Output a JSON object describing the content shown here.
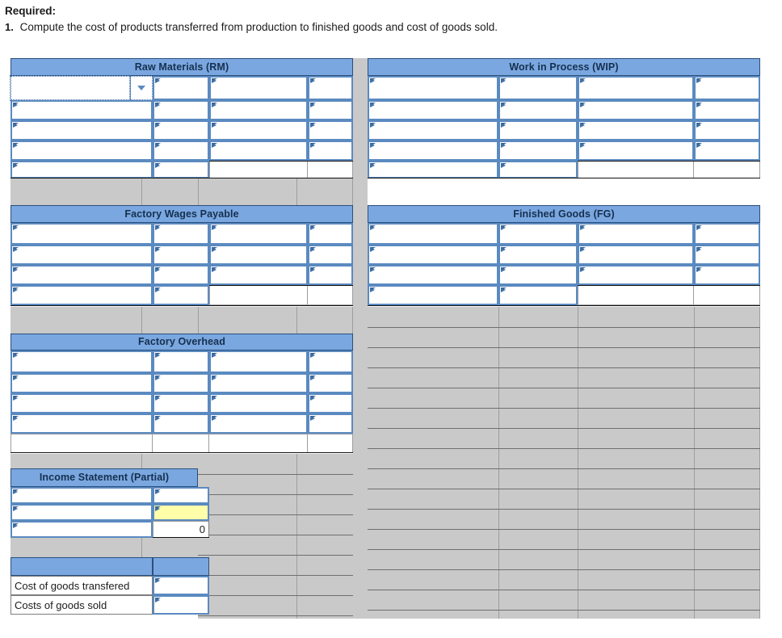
{
  "prompt": {
    "required_label": "Required:",
    "item_number": "1.",
    "item_text": "Compute the cost of products transferred from production to finished goods and cost of goods sold."
  },
  "colors": {
    "header_blue": "#7ba7e0",
    "header_border": "#2b4f7d",
    "input_border": "#5b8ac0",
    "sheet_gray": "#c9c9c9",
    "highlight_yellow": "#ffffaa",
    "text": "#1b1b1b"
  },
  "sections": {
    "raw_materials": {
      "title": "Raw Materials (RM)"
    },
    "work_in_process": {
      "title": "Work in Process (WIP)"
    },
    "factory_wages_payable": {
      "title": "Factory Wages Payable"
    },
    "finished_goods": {
      "title": "Finished Goods (FG)"
    },
    "factory_overhead": {
      "title": "Factory Overhead"
    },
    "income_statement": {
      "title": "Income Statement (Partial)"
    }
  },
  "income_statement_rows": [
    {
      "label": "",
      "value": "",
      "style": "plain"
    },
    {
      "label": "",
      "value": "",
      "style": "yellow"
    },
    {
      "label": "",
      "value": "0",
      "style": "total"
    }
  ],
  "summary_rows": [
    {
      "label": "Cost of goods transfered",
      "value": ""
    },
    {
      "label": "Costs of goods sold",
      "value": ""
    }
  ],
  "active_cell": {
    "value": "",
    "dropdown_icon": "chevron-down-icon"
  }
}
